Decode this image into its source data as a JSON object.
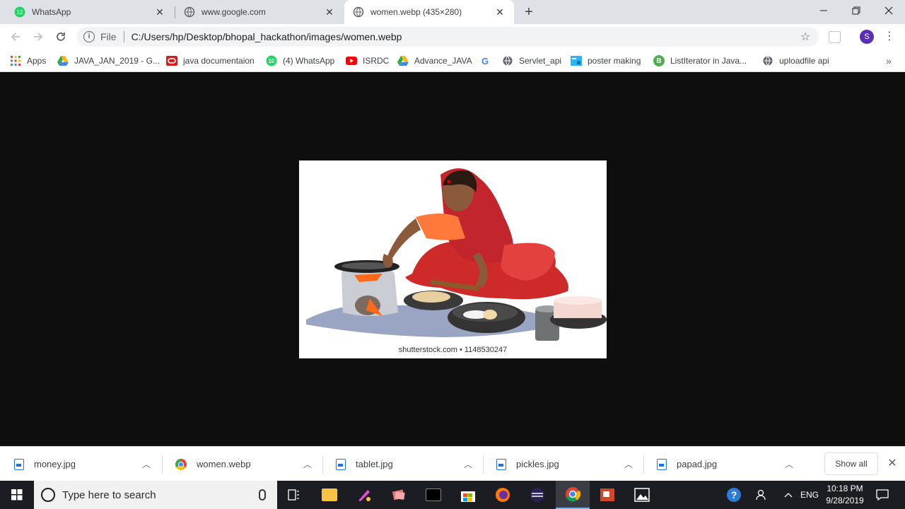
{
  "tabs": [
    {
      "title": "WhatsApp",
      "badge": "12",
      "favicon": "whatsapp-icon"
    },
    {
      "title": "www.google.com",
      "favicon": "globe-icon"
    },
    {
      "title": "women.webp (435×280)",
      "favicon": "globe-icon",
      "active": true
    }
  ],
  "toolbar": {
    "file_label": "File",
    "url": "C:/Users/hp/Desktop/bhopal_hackathon/images/women.webp",
    "profile_initial": "S"
  },
  "bookmarks": [
    {
      "label": "Apps",
      "icon": "apps-grid-icon"
    },
    {
      "label": "JAVA_JAN_2019 - G...",
      "icon": "google-drive-icon"
    },
    {
      "label": "java documentaion",
      "icon": "oracle-icon"
    },
    {
      "label": "(4) WhatsApp",
      "icon": "whatsapp-icon",
      "badge": "10"
    },
    {
      "label": "ISRDC",
      "icon": "youtube-icon"
    },
    {
      "label": "Advance_JAVA",
      "icon": "google-drive-icon"
    },
    {
      "label": "",
      "icon": "google-icon",
      "glyph": "G"
    },
    {
      "label": "Servlet_api",
      "icon": "globe-icon"
    },
    {
      "label": "poster making",
      "icon": "poster-icon"
    },
    {
      "label": "ListIterator in Java...",
      "icon": "b-icon",
      "glyph": "B"
    },
    {
      "label": "uploadfile api",
      "icon": "globe-icon"
    }
  ],
  "image": {
    "watermark": "shutterstock.com • 1148530247"
  },
  "downloads": [
    {
      "name": "money.jpg",
      "icon": "image-file-icon"
    },
    {
      "name": "women.webp",
      "icon": "chrome-icon"
    },
    {
      "name": "tablet.jpg",
      "icon": "image-file-icon"
    },
    {
      "name": "pickles.jpg",
      "icon": "image-file-icon"
    },
    {
      "name": "papad.jpg",
      "icon": "image-file-icon"
    }
  ],
  "downloads_show_all": "Show all",
  "taskbar": {
    "search_placeholder": "Type here to search",
    "language": "ENG",
    "time": "10:18 PM",
    "date": "9/28/2019"
  },
  "colors": {
    "tabstrip": "#dee1e6",
    "content_bg": "#0e0e0e",
    "taskbar": "#1c1d22",
    "avatar": "#5b2fb5"
  }
}
